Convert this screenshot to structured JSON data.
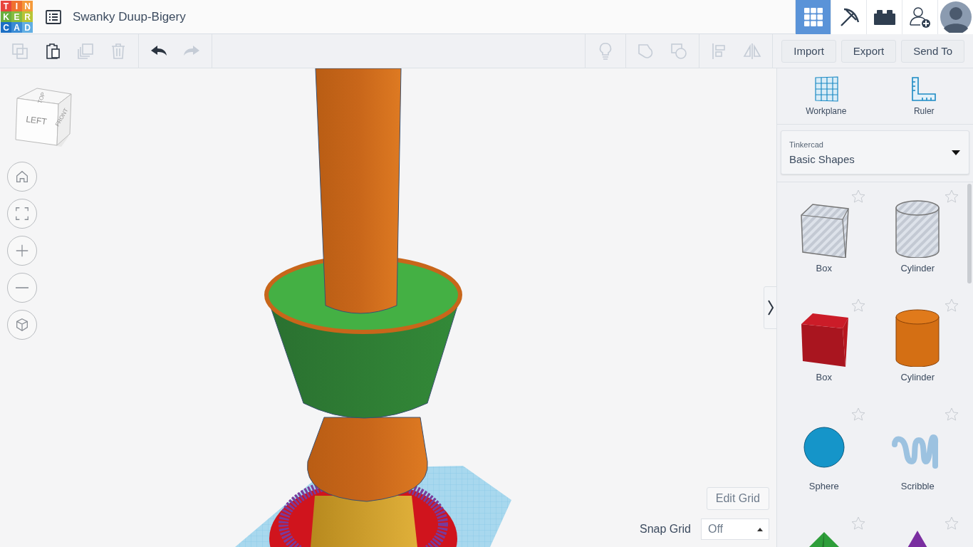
{
  "logo": [
    {
      "letter": "T",
      "color": "#e8453c"
    },
    {
      "letter": "I",
      "color": "#f0712f"
    },
    {
      "letter": "N",
      "color": "#f59a3a"
    },
    {
      "letter": "K",
      "color": "#6aae3e"
    },
    {
      "letter": "E",
      "color": "#86bc3f"
    },
    {
      "letter": "R",
      "color": "#b8c536"
    },
    {
      "letter": "C",
      "color": "#1c6fc4"
    },
    {
      "letter": "A",
      "color": "#3a8bd4"
    },
    {
      "letter": "D",
      "color": "#62aee3"
    }
  ],
  "design_title": "Swanky Duup-Bigery",
  "nav": [
    {
      "kind": "grid",
      "selected": true
    },
    {
      "kind": "pickaxe",
      "selected": false
    },
    {
      "kind": "brick",
      "selected": false
    },
    {
      "kind": "add-user",
      "selected": false
    },
    {
      "kind": "avatar",
      "selected": false
    }
  ],
  "toolbar": {
    "left": [
      [
        {
          "kind": "copy",
          "disabled": true
        },
        {
          "kind": "paste",
          "disabled": false
        },
        {
          "kind": "duplicate",
          "disabled": true
        },
        {
          "kind": "delete",
          "disabled": true
        }
      ],
      [
        {
          "kind": "undo",
          "disabled": false
        },
        {
          "kind": "redo",
          "disabled": true
        }
      ]
    ],
    "right": [
      [
        {
          "kind": "lightbulb",
          "disabled": true
        }
      ],
      [
        {
          "kind": "group",
          "disabled": true
        },
        {
          "kind": "ungroup",
          "disabled": true
        }
      ],
      [
        {
          "kind": "align",
          "disabled": true
        },
        {
          "kind": "mirror",
          "disabled": true
        }
      ]
    ],
    "buttons": [
      "Import",
      "Export",
      "Send To"
    ]
  },
  "view_cube": {
    "faces": [
      "TOP",
      "LEFT",
      "FRONT"
    ]
  },
  "view_controls": [
    {
      "kind": "home"
    },
    {
      "kind": "fit"
    },
    {
      "kind": "zoom-in"
    },
    {
      "kind": "zoom-out"
    },
    {
      "kind": "perspective"
    }
  ],
  "edit_grid": "Edit Grid",
  "snap_grid": {
    "label": "Snap Grid",
    "value": "Off"
  },
  "panel": {
    "tools": [
      "Workplane",
      "Ruler"
    ],
    "library": {
      "label": "Tinkercad",
      "value": "Basic Shapes"
    },
    "shapes": [
      {
        "kind": "box-hole",
        "label": "Box"
      },
      {
        "kind": "cylinder-hole",
        "label": "Cylinder"
      },
      {
        "kind": "box",
        "label": "Box"
      },
      {
        "kind": "cylinder",
        "label": "Cylinder"
      },
      {
        "kind": "sphere",
        "label": "Sphere"
      },
      {
        "kind": "scribble",
        "label": "Scribble"
      },
      {
        "kind": "pyramid"
      },
      {
        "kind": "cone"
      }
    ]
  }
}
